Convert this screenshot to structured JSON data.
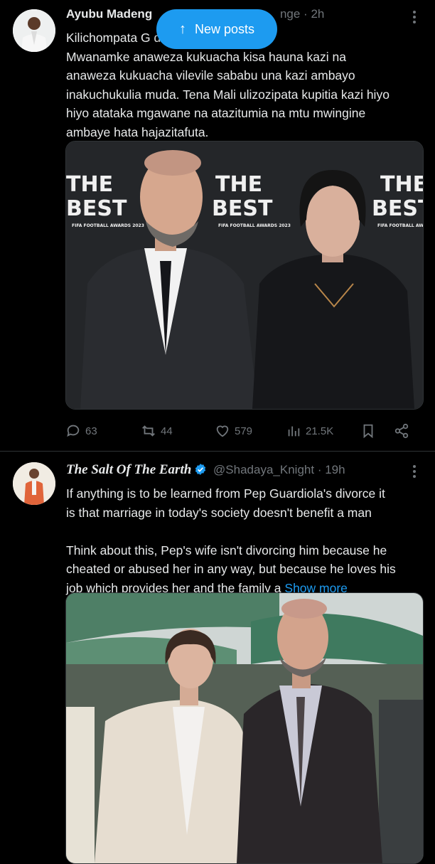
{
  "new_posts_pill": {
    "label": "New posts",
    "icon": "arrow-up-icon"
  },
  "tweets": [
    {
      "author_name": "Ayubu Madeng",
      "handle_fragment": "nge",
      "separator": "·",
      "time": "2h",
      "text": "Kilichompata G                       disha kwamba\nMwanamke anaweza kukuacha kisa hauna kazi na\nanaweza kukuacha vilevile sababu una kazi ambayo\ninakuchukulia muda. Tena Mali ulizozipata kupitia kazi hiyo\nhiyo atataka mgawane na atazitumia na mtu mwingine\nambaye hata hajazitafuta.",
      "media_backdrop_text": [
        "THE",
        "BEST",
        "FIFA FOOTBALL AWARDS 2023"
      ],
      "stats": {
        "replies": "63",
        "reposts": "44",
        "likes": "579",
        "views": "21.5K"
      }
    },
    {
      "author_name": "The Salt Of The Earth",
      "verified": true,
      "handle": "@Shadaya_Knight",
      "separator": "·",
      "time": "19h",
      "text": "If anything is to be learned from Pep Guardiola's divorce it\nis that marriage in today's society doesn't benefit a man\n\nThink about this, Pep's wife isn't divorcing him because he\ncheated or abused her in any way, but because he loves his\njob which provides her and the family a ",
      "show_more": "Show more"
    }
  ],
  "colors": {
    "background": "#000000",
    "accent": "#1d9bf0",
    "muted": "#71767b",
    "text": "#e7e9ea",
    "divider": "#2f3336"
  }
}
